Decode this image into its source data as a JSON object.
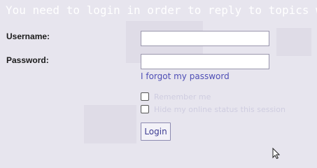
{
  "banner": {
    "text": "You need to login in order to reply to topics within this forum."
  },
  "login_form": {
    "username_label": "Username:",
    "username_value": "",
    "password_label": "Password:",
    "password_value": "",
    "forgot_password_link": "I forgot my password",
    "remember_me_label": "Remember me",
    "remember_me_checked": false,
    "hide_online_label": "Hide my online status this session",
    "hide_online_checked": false,
    "login_button": "Login"
  },
  "colors": {
    "background": "#e7e5ee",
    "link": "#4f4fb6",
    "banner_text": "#ffffff"
  },
  "icons": {
    "cursor": "mouse-pointer-icon"
  }
}
